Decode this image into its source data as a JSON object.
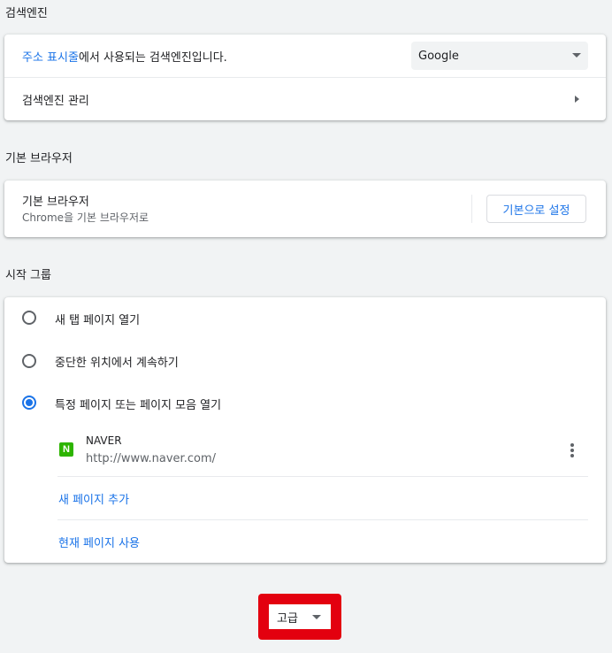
{
  "search_engine": {
    "section_title": "검색엔진",
    "address_bar_link": "주소 표시줄",
    "address_bar_rest": "에서 사용되는 검색엔진입니다.",
    "selected_engine": "Google",
    "manage_label": "검색엔진 관리"
  },
  "default_browser": {
    "section_title": "기본 브라우저",
    "label": "기본 브라우저",
    "sublabel": "Chrome을 기본 브라우저로",
    "make_default_button": "기본으로 설정"
  },
  "startup": {
    "section_title": "시작 그룹",
    "options": [
      {
        "label": "새 탭 페이지 열기",
        "checked": false
      },
      {
        "label": "중단한 위치에서 계속하기",
        "checked": false
      },
      {
        "label": "특정 페이지 또는 페이지 모음 열기",
        "checked": true
      }
    ],
    "page": {
      "favicon_letter": "N",
      "title": "NAVER",
      "url": "http://www.naver.com/"
    },
    "add_page_link": "새 페이지 추가",
    "use_current_link": "현재 페이지 사용"
  },
  "advanced": {
    "label": "고급",
    "highlight_color": "#e3000f"
  },
  "colors": {
    "accent": "#1a73e8",
    "background": "#f1f3f4",
    "naver_green": "#2db400"
  }
}
